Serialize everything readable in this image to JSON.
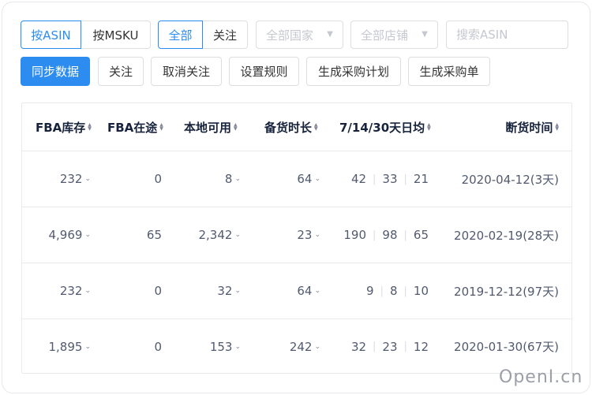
{
  "filters": {
    "mode_tabs": [
      "按ASIN",
      "按MSKU"
    ],
    "follow_tabs": [
      "全部",
      "关注"
    ],
    "country_select": "全部国家",
    "shop_select": "全部店铺",
    "search_placeholder": "搜索ASIN"
  },
  "actions": [
    "同步数据",
    "关注",
    "取消关注",
    "设置规则",
    "生成采购计划",
    "生成采购单"
  ],
  "table": {
    "headers": [
      "FBA库存",
      "FBA在途",
      "本地可用",
      "备货时长",
      "7/14/30天日均",
      "断货时间"
    ],
    "rows": [
      {
        "fba_stock": "232",
        "fba_transit": "0",
        "local": "8",
        "lead": "64",
        "avg7": "42",
        "avg14": "33",
        "avg30": "21",
        "out_date": "2020-04-12(3天)"
      },
      {
        "fba_stock": "4,969",
        "fba_transit": "65",
        "local": "2,342",
        "lead": "23",
        "avg7": "190",
        "avg14": "98",
        "avg30": "65",
        "out_date": "2020-02-19(28天)"
      },
      {
        "fba_stock": "232",
        "fba_transit": "0",
        "local": "32",
        "lead": "64",
        "avg7": "9",
        "avg14": "8",
        "avg30": "10",
        "out_date": "2019-12-12(97天)"
      },
      {
        "fba_stock": "1,895",
        "fba_transit": "0",
        "local": "153",
        "lead": "242",
        "avg7": "32",
        "avg14": "23",
        "avg30": "12",
        "out_date": "2020-01-30(67天)"
      }
    ]
  },
  "watermark": "OpenI.cn",
  "colors": {
    "primary": "#2d8cf0",
    "border": "#dcdee2"
  }
}
